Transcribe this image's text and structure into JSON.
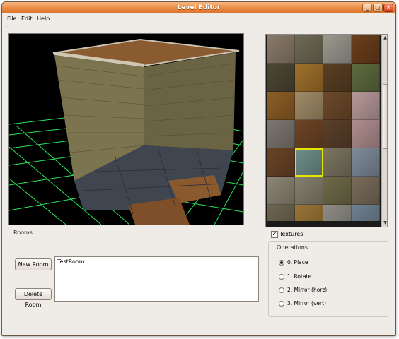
{
  "window": {
    "title": "Level Editor"
  },
  "title_buttons": {
    "minimize": "_",
    "maximize": "▢",
    "close": "×"
  },
  "menu": {
    "file": "File",
    "edit": "Edit",
    "help": "Help"
  },
  "toolbar_separator": "··",
  "rooms": {
    "label": "Rooms",
    "new_room_label": "New Room",
    "delete_room_label": "Delete Room",
    "items": [
      "TestRoom"
    ]
  },
  "textures": {
    "label": "Textures",
    "checked": true,
    "check_glyph": "✓",
    "selected_tile": 17
  },
  "operations": {
    "label": "Operations",
    "options": [
      "0. Place",
      "1. Rotate",
      "2. Mirror (horz)",
      "3. Mirror (vert)"
    ],
    "selected": 0
  },
  "scrollbar": {
    "up": "▲",
    "down": "▼"
  },
  "colors": {
    "titlebar": "#e98a43",
    "window_bg": "#efebe7",
    "viewport_bg": "#000000",
    "grid": "#33ff66",
    "selection": "#e8e400"
  },
  "texture_tiles": [
    {
      "icon": "carved-stone",
      "color": "#8a7b6a"
    },
    {
      "icon": "stone-wall",
      "color": "#6e6a55"
    },
    {
      "icon": "gray-stone",
      "color": "#9a9a90"
    },
    {
      "icon": "ornate-brown",
      "color": "#6b3e1c"
    },
    {
      "icon": "dark-brick",
      "color": "#4d4733"
    },
    {
      "icon": "gold-triangle",
      "color": "#a0712b"
    },
    {
      "icon": "dark-wood",
      "color": "#5a3f24"
    },
    {
      "icon": "moss-stone",
      "color": "#5e6b3f"
    },
    {
      "icon": "ornate-gold",
      "color": "#8d5e26"
    },
    {
      "icon": "tan-stone",
      "color": "#a08c68"
    },
    {
      "icon": "wood-panel",
      "color": "#6d4a2a"
    },
    {
      "icon": "pink-marble",
      "color": "#b79a98"
    },
    {
      "icon": "gargoyle",
      "color": "#7d7770"
    },
    {
      "icon": "ornate-brown",
      "color": "#6e4425"
    },
    {
      "icon": "dark-wood",
      "color": "#5a402a"
    },
    {
      "icon": "pink-ornate",
      "color": "#b08e8e"
    },
    {
      "icon": "wood-pattern",
      "color": "#6a4425"
    },
    {
      "icon": "teal-tiles",
      "color": "#6e8e88"
    },
    {
      "icon": "stone-wall",
      "color": "#7b7560"
    },
    {
      "icon": "blue-tiles",
      "color": "#7e8b9a"
    },
    {
      "icon": "arched-window",
      "color": "#8e8676"
    },
    {
      "icon": "cobblestone",
      "color": "#85806e"
    },
    {
      "icon": "selected-stone",
      "color": "#6f6a48"
    },
    {
      "icon": "arched-window",
      "color": "#7a6c5a"
    },
    {
      "icon": "brick",
      "color": "#6e6650"
    },
    {
      "icon": "gold-panel",
      "color": "#9a7436"
    },
    {
      "icon": "gray-stone",
      "color": "#8e8c84"
    },
    {
      "icon": "blue-stone",
      "color": "#6f8090"
    },
    {
      "icon": "pink-marble",
      "color": "#b59c9e"
    },
    {
      "icon": "gold-panel",
      "color": "#a07a3e"
    },
    {
      "icon": "dark-slate",
      "color": "#3e3e3e"
    },
    {
      "icon": "ornate-brown",
      "color": "#745033"
    },
    {
      "icon": "mossy-stone",
      "color": "#6a6a55"
    },
    {
      "icon": "tan-stone",
      "color": "#9a8460"
    },
    {
      "icon": "dark-brick",
      "color": "#55503f"
    },
    {
      "icon": "gray-stone",
      "color": "#8e8a80"
    }
  ]
}
